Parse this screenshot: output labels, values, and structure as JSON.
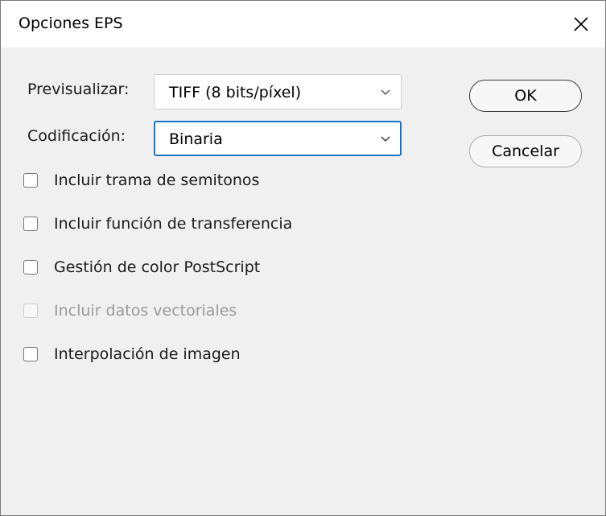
{
  "dialog": {
    "title": "Opciones EPS",
    "close_icon": "close-icon"
  },
  "fields": {
    "preview": {
      "label": "Previsualizar:",
      "mnemonic": "P",
      "value": "TIFF (8 bits/píxel)"
    },
    "encoding": {
      "label": "Codificación:",
      "mnemonic": "C",
      "value": "Binaria"
    }
  },
  "buttons": {
    "ok": "OK",
    "cancel": "Cancelar"
  },
  "checkboxes": [
    {
      "label": "Incluir trama de semitonos",
      "checked": false,
      "enabled": true
    },
    {
      "label": "Incluir función de transferencia",
      "checked": false,
      "enabled": true
    },
    {
      "label": "Gestión de color PostScript",
      "checked": false,
      "enabled": true
    },
    {
      "label": "Incluir datos vectoriales",
      "checked": false,
      "enabled": false
    },
    {
      "label": "Interpolación de imagen",
      "checked": false,
      "enabled": true
    }
  ],
  "colors": {
    "focus": "#1a73c8",
    "background": "#f0f0f0",
    "disabled_text": "#9a9a9a"
  }
}
